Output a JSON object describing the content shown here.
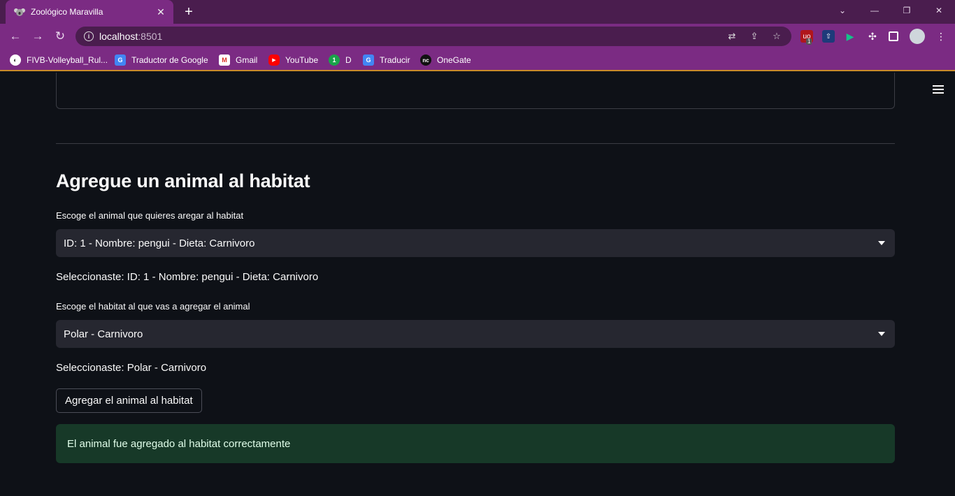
{
  "browser": {
    "tab_title": "Zoológico Maravilla",
    "url_host": "localhost",
    "url_port": ":8501",
    "bookmarks": [
      {
        "label": "FIVB-Volleyball_Rul...",
        "icon": "globe-icon"
      },
      {
        "label": "Traductor de Google",
        "icon": "google-translate-icon"
      },
      {
        "label": "Gmail",
        "icon": "gmail-icon"
      },
      {
        "label": "YouTube",
        "icon": "youtube-icon"
      },
      {
        "label": "D",
        "icon": "green-circle-icon"
      },
      {
        "label": "Traducir",
        "icon": "google-translate-icon"
      },
      {
        "label": "OneGate",
        "icon": "onegate-icon"
      }
    ],
    "ext_badge": "1",
    "colors": {
      "tabbar": "#4a1d4e",
      "toolbar": "#7b2b83",
      "accent_line": "#c98a2a"
    }
  },
  "main": {
    "section_title": "Agregue un animal al habitat",
    "animal_select": {
      "label": "Escoge el animal que quieres aregar al habitat",
      "value": "ID: 1 - Nombre: pengui - Dieta: Carnivoro"
    },
    "animal_selected_text": "Seleccionaste: ID: 1 - Nombre: pengui - Dieta: Carnivoro",
    "habitat_select": {
      "label": "Escoge el habitat al que vas a agregar el animal",
      "value": "Polar - Carnivoro"
    },
    "habitat_selected_text": "Seleccionaste: Polar - Carnivoro",
    "submit_button": "Agregar el animal al habitat",
    "success_message": "El animal fue agregado al habitat correctamente",
    "colors": {
      "background": "#0e1117",
      "select_bg": "#262730",
      "success_bg": "#173928",
      "success_text": "#dffde9"
    }
  }
}
